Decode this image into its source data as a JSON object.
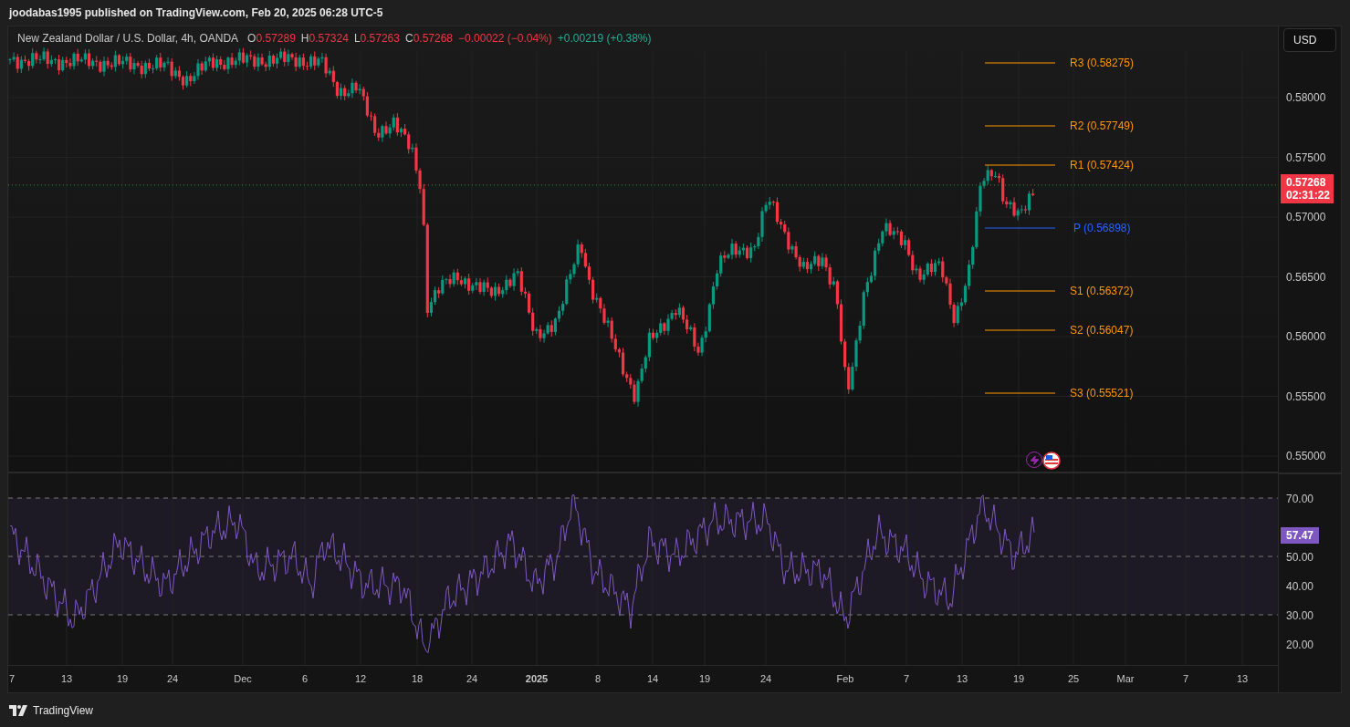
{
  "publisher": "joodabas1995 published on TradingView.com, Feb 20, 2025 06:28 UTC-5",
  "legend": {
    "symbol": "New Zealand Dollar / U.S. Dollar, 4h, OANDA",
    "ohlc": [
      {
        "label": "O",
        "value": "0.57289"
      },
      {
        "label": "H",
        "value": "0.57324"
      },
      {
        "label": "L",
        "value": "0.57263"
      },
      {
        "label": "C",
        "value": "0.57268"
      }
    ],
    "changes": [
      {
        "text": "−0.00022 (−0.04%)",
        "kind": "down"
      },
      {
        "text": "+0.00219 (+0.38%)",
        "kind": "up"
      }
    ]
  },
  "currency_button": "USD",
  "price_axis": [
    "0.58000",
    "0.57500",
    "0.57000",
    "0.56500",
    "0.56000",
    "0.55500",
    "0.55000"
  ],
  "current_price": {
    "price": "0.57268",
    "countdown": "02:31:22"
  },
  "pivots": [
    {
      "label": "R3 (0.58275)",
      "color": "#ff9800"
    },
    {
      "label": "R2 (0.57749)",
      "color": "#ff9800"
    },
    {
      "label": "R1 (0.57424)",
      "color": "#ff9800"
    },
    {
      "label": "P (0.56898)",
      "color": "#2962ff"
    },
    {
      "label": "S1 (0.56372)",
      "color": "#ff9800"
    },
    {
      "label": "S2 (0.56047)",
      "color": "#ff9800"
    },
    {
      "label": "S3 (0.55521)",
      "color": "#ff9800"
    }
  ],
  "rsi_axis": [
    "70.00",
    "50.00",
    "40.00",
    "30.00",
    "20.00"
  ],
  "rsi_value": "57.47",
  "time_axis": [
    {
      "label": "7",
      "bold": false
    },
    {
      "label": "13",
      "bold": false
    },
    {
      "label": "19",
      "bold": false
    },
    {
      "label": "24",
      "bold": false
    },
    {
      "label": "Dec",
      "bold": false
    },
    {
      "label": "6",
      "bold": false
    },
    {
      "label": "12",
      "bold": false
    },
    {
      "label": "18",
      "bold": false
    },
    {
      "label": "24",
      "bold": false
    },
    {
      "label": "2025",
      "bold": true
    },
    {
      "label": "8",
      "bold": false
    },
    {
      "label": "14",
      "bold": false
    },
    {
      "label": "19",
      "bold": false
    },
    {
      "label": "24",
      "bold": false
    },
    {
      "label": "Feb",
      "bold": false
    },
    {
      "label": "7",
      "bold": false
    },
    {
      "label": "13",
      "bold": false
    },
    {
      "label": "19",
      "bold": false
    },
    {
      "label": "25",
      "bold": false
    },
    {
      "label": "Mar",
      "bold": false
    },
    {
      "label": "7",
      "bold": false
    },
    {
      "label": "13",
      "bold": false
    }
  ],
  "footer": {
    "brand": "TradingView"
  }
}
